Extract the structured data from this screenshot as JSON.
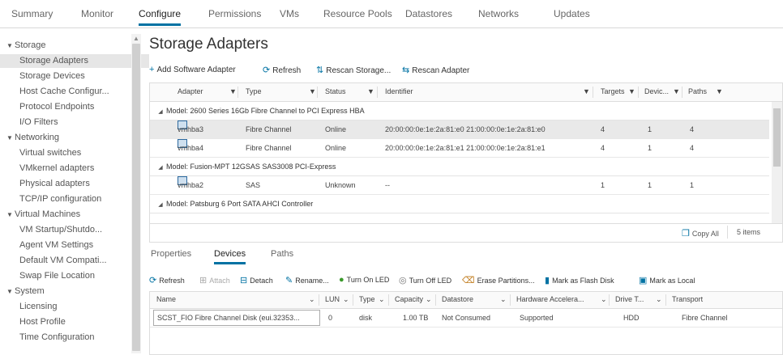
{
  "topnav": {
    "tabs": [
      "Summary",
      "Monitor",
      "Configure",
      "Permissions",
      "VMs",
      "Resource Pools",
      "Datastores",
      "Networks",
      "Updates"
    ],
    "active": "Configure"
  },
  "sidebar": {
    "items": [
      {
        "label": "Storage",
        "group": true
      },
      {
        "label": "Storage Adapters",
        "selected": true
      },
      {
        "label": "Storage Devices"
      },
      {
        "label": "Host Cache Configur..."
      },
      {
        "label": "Protocol Endpoints"
      },
      {
        "label": "I/O Filters"
      },
      {
        "label": "Networking",
        "group": true
      },
      {
        "label": "Virtual switches"
      },
      {
        "label": "VMkernel adapters"
      },
      {
        "label": "Physical adapters"
      },
      {
        "label": "TCP/IP configuration"
      },
      {
        "label": "Virtual Machines",
        "group": true
      },
      {
        "label": "VM Startup/Shutdo..."
      },
      {
        "label": "Agent VM Settings"
      },
      {
        "label": "Default VM Compati..."
      },
      {
        "label": "Swap File Location"
      },
      {
        "label": "System",
        "group": true
      },
      {
        "label": "Licensing"
      },
      {
        "label": "Host Profile"
      },
      {
        "label": "Time Configuration"
      }
    ]
  },
  "main": {
    "title": "Storage Adapters",
    "toolbar": {
      "add": "Add Software Adapter",
      "refresh": "Refresh",
      "rescan_storage": "Rescan Storage...",
      "rescan_adapter": "Rescan Adapter"
    },
    "grid": {
      "columns": [
        "Adapter",
        "Type",
        "Status",
        "Identifier",
        "Targets",
        "Devic...",
        "Paths"
      ],
      "groups": [
        {
          "title": "Model: 2600 Series 16Gb Fibre Channel to PCI Express HBA",
          "rows": [
            {
              "adapter": "vmhba3",
              "type": "Fibre Channel",
              "status": "Online",
              "identifier": "20:00:00:0e:1e:2a:81:e0 21:00:00:0e:1e:2a:81:e0",
              "targets": "4",
              "devices": "1",
              "paths": "4",
              "selected": true
            },
            {
              "adapter": "vmhba4",
              "type": "Fibre Channel",
              "status": "Online",
              "identifier": "20:00:00:0e:1e:2a:81:e1 21:00:00:0e:1e:2a:81:e1",
              "targets": "4",
              "devices": "1",
              "paths": "4"
            }
          ]
        },
        {
          "title": "Model: Fusion-MPT 12GSAS SAS3008 PCI-Express",
          "rows": [
            {
              "adapter": "vmhba2",
              "type": "SAS",
              "status": "Unknown",
              "identifier": "--",
              "targets": "1",
              "devices": "1",
              "paths": "1"
            }
          ]
        },
        {
          "title": "Model: Patsburg 6 Port SATA AHCI Controller",
          "rows": []
        }
      ],
      "copy_all": "Copy All",
      "items_count": "5 items"
    },
    "subtabs": {
      "tabs": [
        "Properties",
        "Devices",
        "Paths"
      ],
      "active": "Devices"
    },
    "toolbar2": {
      "refresh": "Refresh",
      "attach": "Attach",
      "detach": "Detach",
      "rename": "Rename...",
      "turn_on_led": "Turn On LED",
      "turn_off_led": "Turn Off LED",
      "erase_partitions": "Erase Partitions...",
      "mark_flash": "Mark as Flash Disk",
      "mark_local": "Mark as Local"
    },
    "grid2": {
      "columns": [
        "Name",
        "LUN",
        "Type",
        "Capacity",
        "Datastore",
        "Hardware Accelera...",
        "Drive T...",
        "Transport"
      ],
      "row": {
        "name": "SCST_FIO Fibre Channel Disk (eui.32353...",
        "lun": "0",
        "type": "disk",
        "capacity": "1.00 TB",
        "datastore": "Not Consumed",
        "hw": "Supported",
        "drive": "HDD",
        "transport": "Fibre Channel"
      }
    }
  },
  "colors": {
    "accent": "#0072a3",
    "selected_row": "#e9e9e9"
  }
}
